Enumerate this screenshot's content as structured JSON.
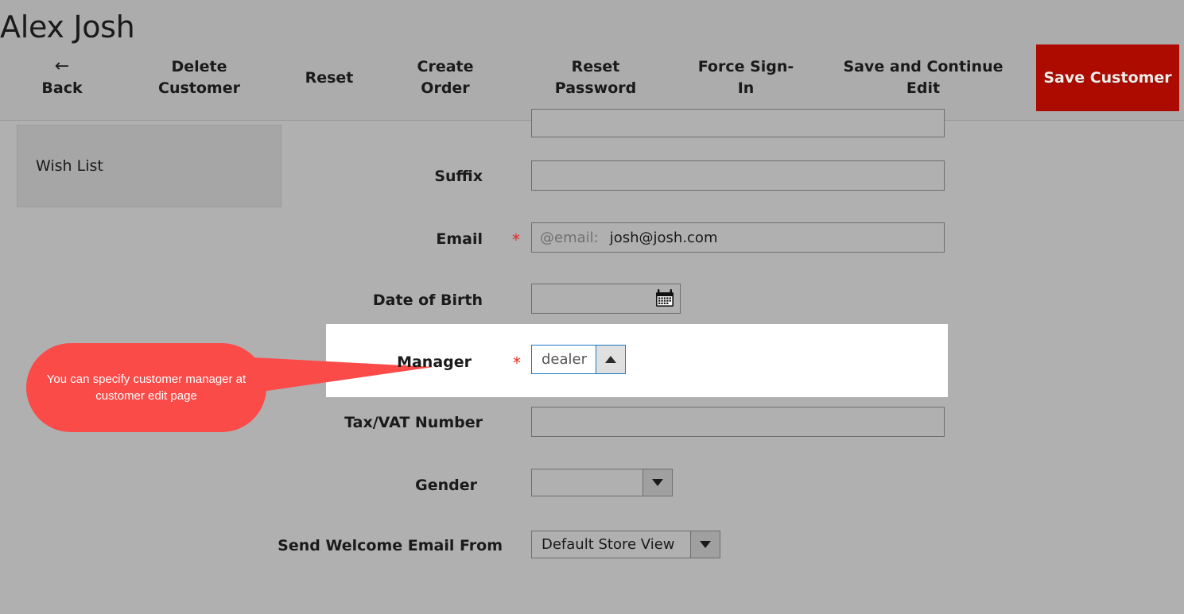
{
  "page": {
    "title": "Alex Josh",
    "background_color": "#b0b0b0",
    "header_background": "#acacac",
    "accent_color": "#ad0b00",
    "required_marker": "*"
  },
  "header": {
    "actions": [
      {
        "label": "Back",
        "icon": "arrow-left-icon",
        "glyph": "←",
        "primary": false
      },
      {
        "label": "Delete Customer",
        "primary": false
      },
      {
        "label": "Reset",
        "primary": false
      },
      {
        "label": "Create Order",
        "primary": false
      },
      {
        "label": "Reset Password",
        "primary": false
      },
      {
        "label": "Force Sign-In",
        "primary": false
      },
      {
        "label": "Save and Continue Edit",
        "primary": false
      },
      {
        "label": "Save Customer",
        "primary": true
      }
    ]
  },
  "sidebar": {
    "items": [
      {
        "label": "Wish List",
        "active": false
      }
    ]
  },
  "form": {
    "fields": {
      "suffix": {
        "label": "Suffix",
        "value": "",
        "required": false
      },
      "email": {
        "label": "Email",
        "required": true,
        "prefix": "@email:",
        "value": "josh@josh.com"
      },
      "date_of_birth": {
        "label": "Date of Birth",
        "value": "",
        "required": false,
        "icon": "calendar-icon"
      },
      "manager": {
        "label": "Manager",
        "required": true,
        "value": "dealer",
        "focused": true,
        "arrow": "chevron-up-icon"
      },
      "tax_vat_number": {
        "label": "Tax/VAT Number",
        "value": "",
        "required": false
      },
      "gender": {
        "label": "Gender",
        "value": "",
        "required": false,
        "arrow": "chevron-down-icon"
      },
      "send_welcome_email_from": {
        "label": "Send Welcome Email From",
        "value": "Default Store View",
        "required": false,
        "arrow": "chevron-down-icon"
      }
    }
  },
  "callout": {
    "text": "You can specify customer manager at customer edit page",
    "color": "#fb4b48",
    "text_color": "#ffffff"
  }
}
